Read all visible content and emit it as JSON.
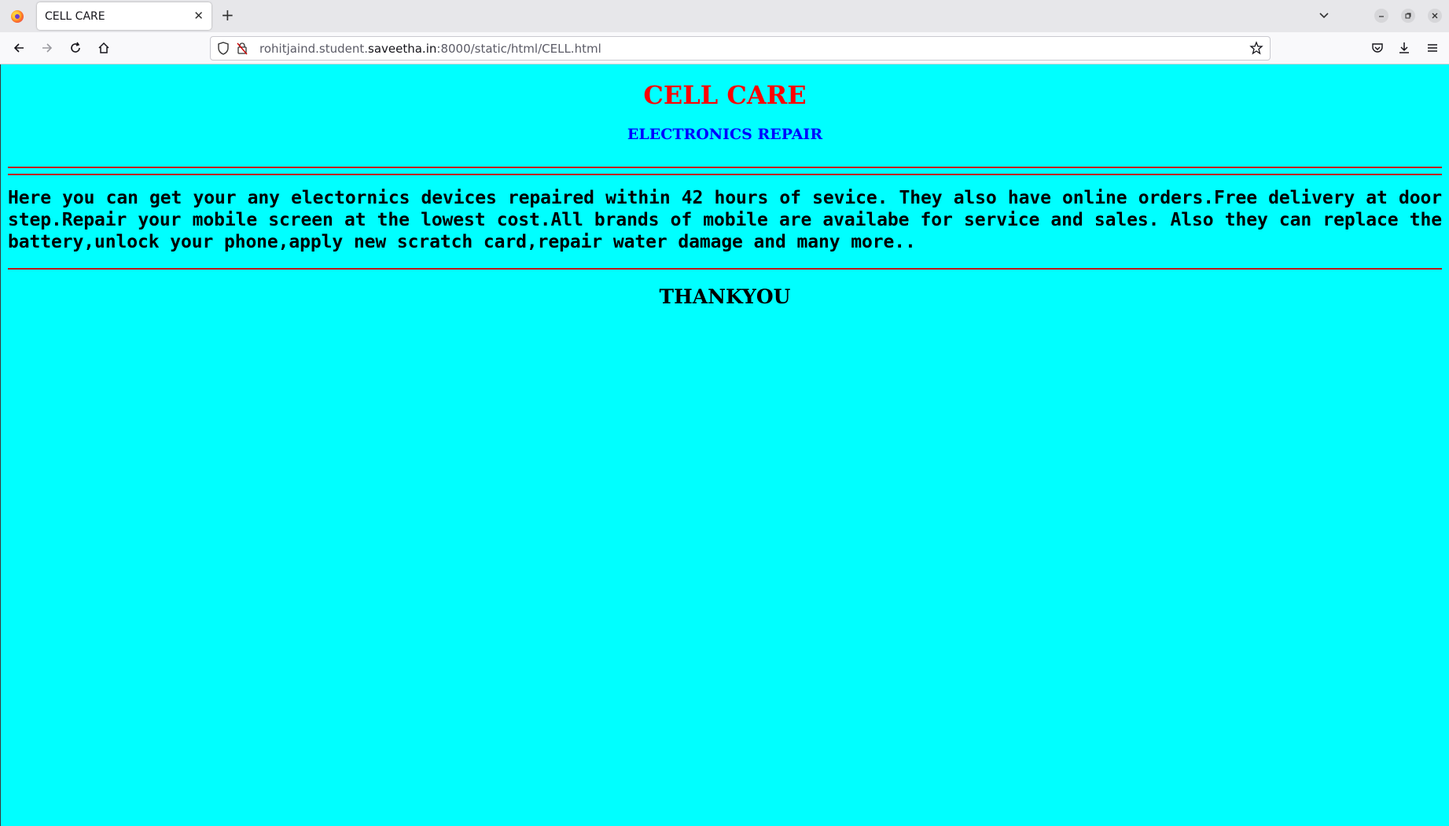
{
  "browser": {
    "tab_title": "CELL CARE",
    "tab_close": "✕",
    "new_tab": "+",
    "url_prefix": "rohitjaind.student.",
    "url_domain": "saveetha.in",
    "url_suffix": ":8000/static/html/CELL.html",
    "icons": [
      "firefox-logo",
      "back-arrow",
      "forward-arrow",
      "reload",
      "home",
      "shield",
      "insecure-lock",
      "bookmark-star",
      "pocket",
      "downloads",
      "menu",
      "list-all-tabs",
      "minimize",
      "restore",
      "close"
    ]
  },
  "page": {
    "background": "#00ffff",
    "title": "CELL CARE",
    "title_color": "#ff0000",
    "subtitle": "ELECTRONICS REPAIR",
    "subtitle_color": "#0000ff",
    "rule_color": "#c01818",
    "paragraph": "Here you can get your any electornics devices repaired within 42 hours of sevice. They also have online orders.Free delivery at door step.Repair your mobile screen at the lowest cost.All brands of mobile are availabe for service and sales. Also they can replace the battery,unlock your phone,apply new scratch card,repair water damage and many more..",
    "closing": "THANKYOU"
  }
}
